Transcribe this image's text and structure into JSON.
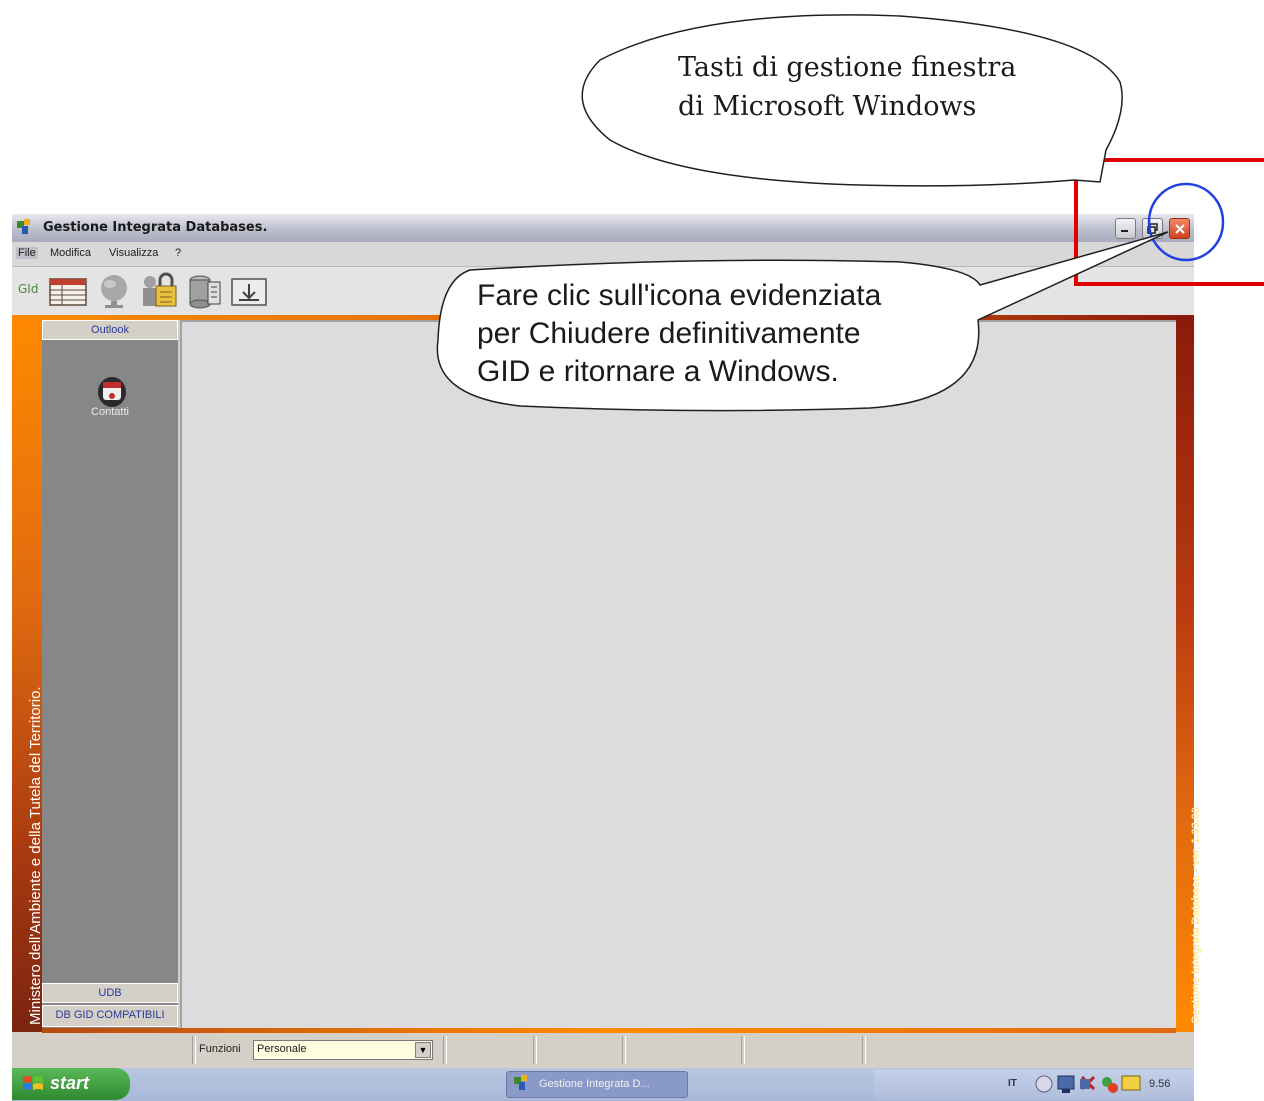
{
  "window": {
    "title": "Gestione Integrata Databases.",
    "icon": "gid-app-icon"
  },
  "menu": {
    "items": [
      "File",
      "Modifica",
      "Visualizza",
      "?"
    ]
  },
  "toolbar": {
    "label": "GId",
    "buttons": [
      "table-icon",
      "globe-icon",
      "users-lock-icon",
      "database-icon",
      "export-icon"
    ]
  },
  "sidebar": {
    "outlook_header": "Outlook",
    "item_label": "Contatti",
    "udb_header": "UDB",
    "dbgid_header": "DB GID COMPATIBILI"
  },
  "branding": {
    "left_text": "Ministero dell'Ambiente e della Tutela del Territorio.",
    "right_text": "Gestione Integrata Database - ver. 1.03.00"
  },
  "statusbar": {
    "funzioni_label": "Funzioni",
    "funzioni_value": "Personale"
  },
  "taskbar": {
    "start_label": "start",
    "task_label": "Gestione Integrata D...",
    "language": "IT",
    "clock": "9.56"
  },
  "callouts": {
    "top": "Tasti di gestione finestra\ndi Microsoft Windows",
    "middle": "Fare clic sull'icona evidenziata\nper Chiudere definitivamente\nGID e ritornare a Windows."
  },
  "colors": {
    "highlight_box": "#e00000",
    "highlight_circle": "#2040e0",
    "frame_orange": "#ff8a00",
    "close_button": "#d04020"
  }
}
